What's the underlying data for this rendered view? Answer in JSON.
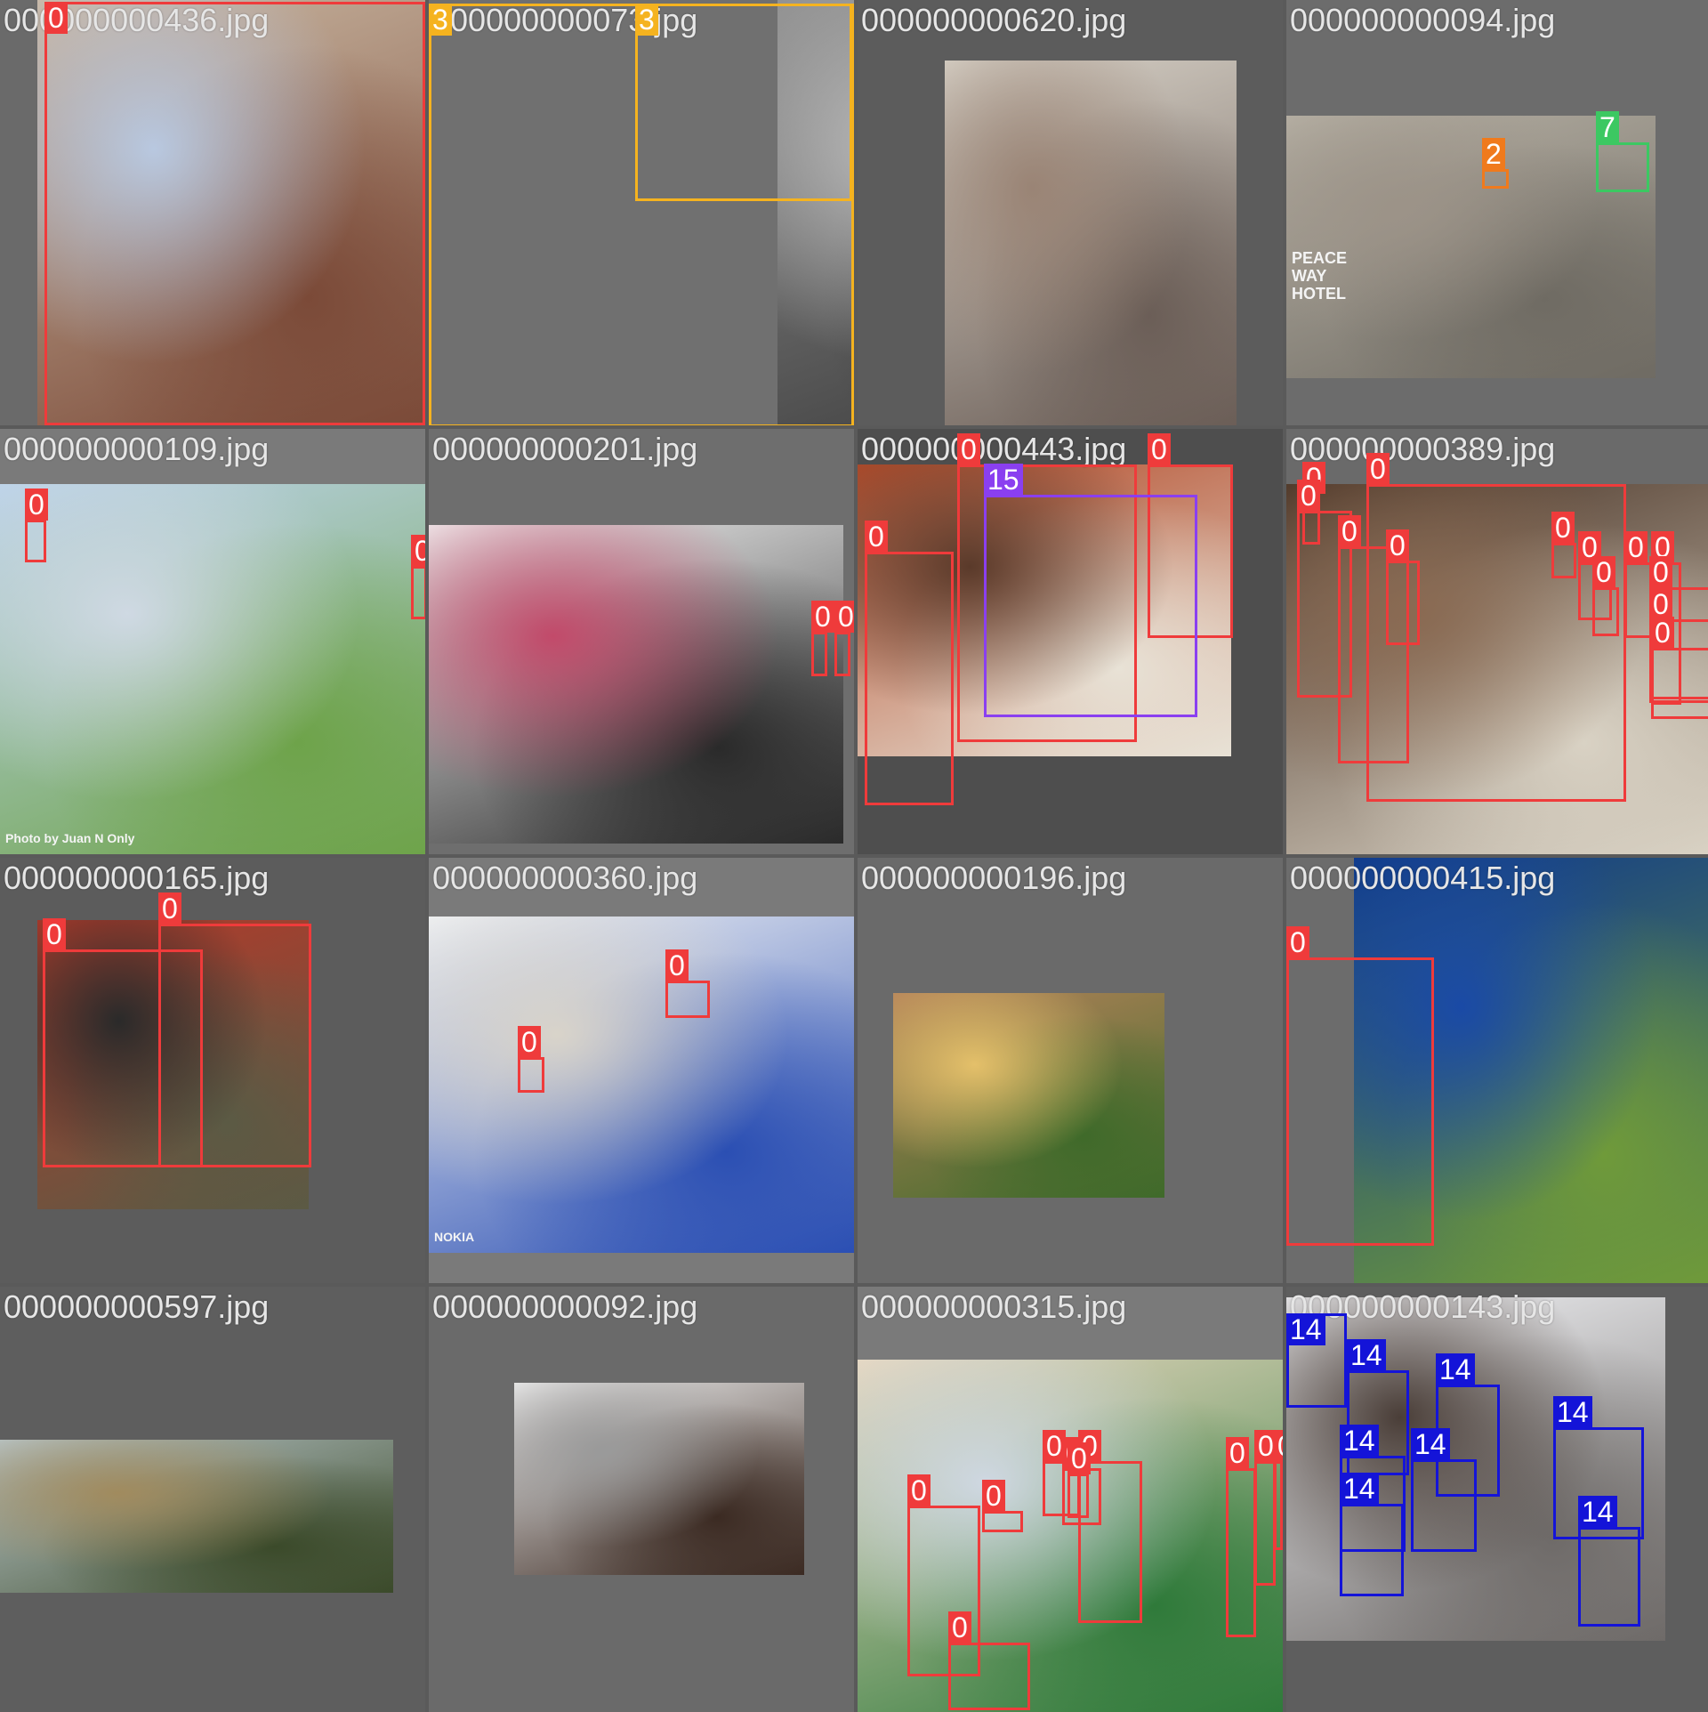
{
  "title": "",
  "class_colors": {
    "0": "#ef3b3b",
    "2": "#f07a1c",
    "3": "#f5b31f",
    "7": "#3cc862",
    "14": "#1414d8",
    "15": "#8a3ff0"
  },
  "tiles": [
    {
      "filename": "000000000436.jpg",
      "scene": "man-eating-pastry",
      "background": "#6a6a6a",
      "photo_colors": [
        "#c9b7a2",
        "#7b4a38",
        "#b8c8e0"
      ],
      "boxes": [
        {
          "label": "0"
        }
      ]
    },
    {
      "filename": "000000000073.jpg",
      "scene": "vintage-motorcycle",
      "background": "#707070",
      "photo_colors": [
        "#8d8d8d",
        "#3a3a3a",
        "#bdbdbd"
      ],
      "boxes": [
        {
          "label": "3"
        },
        {
          "label": "3"
        }
      ]
    },
    {
      "filename": "000000000620.jpg",
      "scene": "pizza-oven-rack",
      "background": "#5c5c5c",
      "photo_colors": [
        "#d8d2c8",
        "#6b5e57",
        "#9a8475"
      ],
      "boxes": []
    },
    {
      "filename": "000000000094.jpg",
      "scene": "peace-way-hotel-street",
      "background": "#6c6c6c",
      "photo_colors": [
        "#b7b1a5",
        "#6f6b63",
        "#9c9388"
      ],
      "photo_texts": [
        "PEACE",
        "WAY",
        "HOTEL"
      ],
      "boxes": [
        {
          "label": "2"
        },
        {
          "label": "7"
        }
      ]
    },
    {
      "filename": "000000000109.jpg",
      "scene": "riverside-park",
      "background": "#7a7a7a",
      "photo_colors": [
        "#bcd3ea",
        "#6ea34a",
        "#cfd9e3"
      ],
      "photo_texts": [
        "Photo by Juan N Only"
      ],
      "boxes": [
        {
          "label": "0"
        },
        {
          "label": "0"
        }
      ]
    },
    {
      "filename": "000000000201.jpg",
      "scene": "snowboards-on-rack",
      "background": "#6e6e6e",
      "photo_colors": [
        "#f2f2f2",
        "#2a2a2a",
        "#c24a6a"
      ],
      "boxes": [
        {
          "label": "0"
        },
        {
          "label": "0"
        }
      ]
    },
    {
      "filename": "000000000443.jpg",
      "scene": "cat-on-lap",
      "background": "#4e4e4e",
      "photo_colors": [
        "#b34b2a",
        "#e8e2d6",
        "#5a3a2a"
      ],
      "boxes": [
        {
          "label": "0"
        },
        {
          "label": "0"
        },
        {
          "label": "0"
        },
        {
          "label": "15"
        }
      ]
    },
    {
      "filename": "000000000389.jpg",
      "scene": "bearded-man-crowd",
      "background": "#6a6a6a",
      "photo_colors": [
        "#4a3426",
        "#d9d2c4",
        "#8a6a52"
      ],
      "boxes": [
        {
          "label": "0"
        },
        {
          "label": "0"
        },
        {
          "label": "0"
        },
        {
          "label": "0"
        },
        {
          "label": "0"
        },
        {
          "label": "0"
        },
        {
          "label": "0"
        },
        {
          "label": "0"
        },
        {
          "label": "0"
        },
        {
          "label": "0"
        },
        {
          "label": "0"
        },
        {
          "label": "0"
        },
        {
          "label": "0"
        }
      ]
    },
    {
      "filename": "000000000165.jpg",
      "scene": "ribbon-cutting",
      "background": "#5c5c5c",
      "photo_colors": [
        "#b23a2a",
        "#5b5a44",
        "#2a2a2a"
      ],
      "boxes": [
        {
          "label": "0"
        },
        {
          "label": "0"
        }
      ]
    },
    {
      "filename": "000000000360.jpg",
      "scene": "snowboard-jump-nokia",
      "background": "#7a7a7a",
      "photo_colors": [
        "#f0f2f4",
        "#2b4fb3",
        "#d9d4ca"
      ],
      "photo_texts": [
        "NOKIA"
      ],
      "boxes": [
        {
          "label": "0"
        },
        {
          "label": "0"
        }
      ]
    },
    {
      "filename": "000000000196.jpg",
      "scene": "food-buffet",
      "background": "#6a6a6a",
      "photo_colors": [
        "#b5835a",
        "#3f6a2a",
        "#e4c06a"
      ],
      "boxes": []
    },
    {
      "filename": "000000000415.jpg",
      "scene": "tennis-serve",
      "background": "#6c6c6c",
      "photo_colors": [
        "#0f3a8a",
        "#6f9a3a",
        "#1a4aa6"
      ],
      "boxes": [
        {
          "label": "0"
        }
      ]
    },
    {
      "filename": "000000000597.jpg",
      "scene": "elephants-savanna",
      "background": "#5e5e5e",
      "photo_colors": [
        "#b9c6c9",
        "#3b4a2a",
        "#a18b5e"
      ],
      "boxes": []
    },
    {
      "filename": "000000000092.jpg",
      "scene": "chocolate-cake-plate",
      "background": "#6a6a6a",
      "photo_colors": [
        "#eeeeee",
        "#3b2a22",
        "#9a9a9a"
      ],
      "boxes": []
    },
    {
      "filename": "000000000315.jpg",
      "scene": "crowded-beach",
      "background": "#7a7a7a",
      "photo_colors": [
        "#e8d8c0",
        "#2f7a3a",
        "#cfd8e2"
      ],
      "boxes": [
        {
          "label": "0"
        },
        {
          "label": "0"
        },
        {
          "label": "0"
        },
        {
          "label": "0"
        },
        {
          "label": "0"
        },
        {
          "label": "0"
        },
        {
          "label": "0"
        },
        {
          "label": "0"
        },
        {
          "label": "0"
        },
        {
          "label": "0"
        }
      ]
    },
    {
      "filename": "000000000143.jpg",
      "scene": "birds-on-branches",
      "background": "#5e5e5e",
      "photo_colors": [
        "#f4f5f8",
        "#6e6a68",
        "#4a3e38"
      ],
      "boxes": [
        {
          "label": "14"
        },
        {
          "label": "14"
        },
        {
          "label": "14"
        },
        {
          "label": "14"
        },
        {
          "label": "14"
        },
        {
          "label": "14"
        },
        {
          "label": "14"
        },
        {
          "label": "14"
        }
      ]
    }
  ]
}
